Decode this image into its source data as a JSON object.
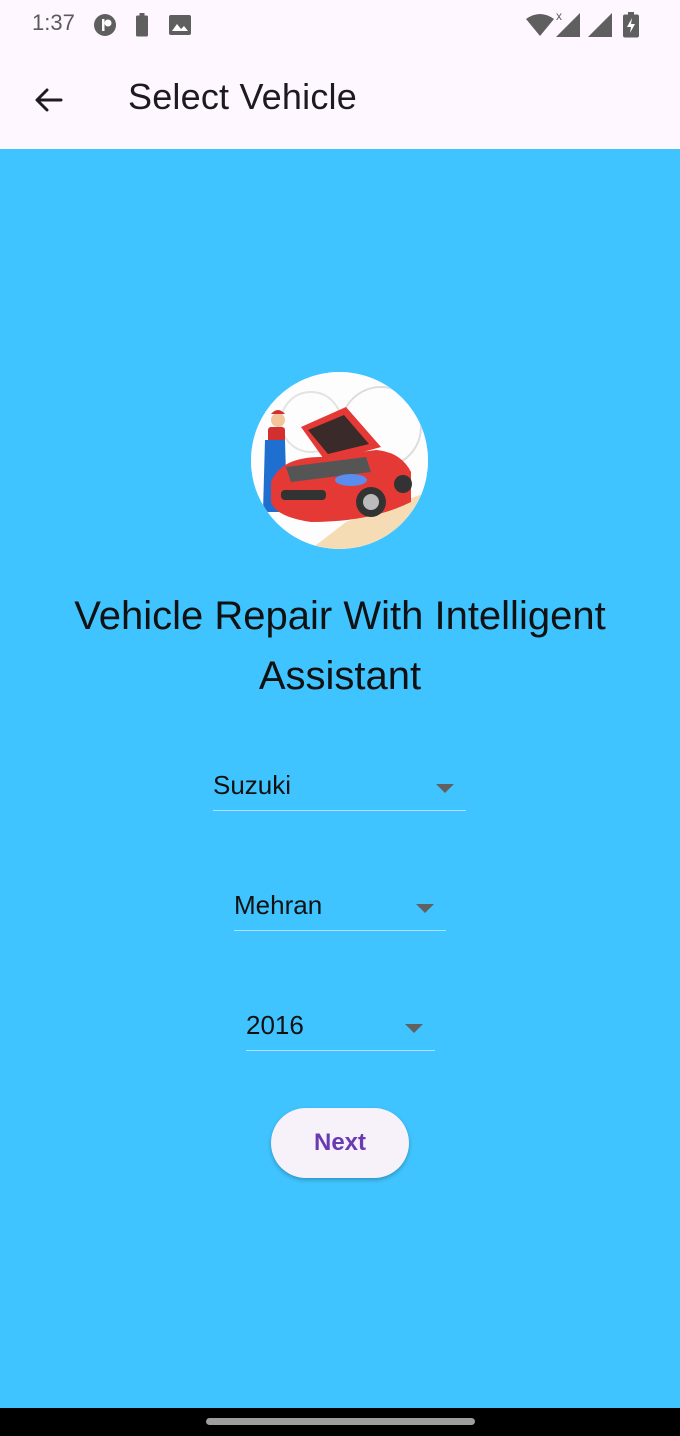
{
  "status_bar": {
    "time": "1:37",
    "left_icons": [
      "app-notification-icon",
      "battery-saver-icon",
      "image-icon"
    ],
    "right_icons": [
      "wifi-icon",
      "cell-signal-no-data-icon",
      "cell-signal-icon",
      "battery-charging-icon"
    ],
    "no_data_mark": "x"
  },
  "app_bar": {
    "title": "Select Vehicle",
    "back_icon": "arrow-back-icon"
  },
  "main": {
    "logo_alt": "Mechanic repairing red car",
    "heading": "Vehicle Repair With Intelligent Assistant",
    "dropdowns": [
      {
        "name": "make",
        "value": "Suzuki"
      },
      {
        "name": "model",
        "value": "Mehran"
      },
      {
        "name": "year",
        "value": "2016"
      }
    ],
    "next_button": "Next"
  },
  "colors": {
    "background": "#40C4FF",
    "app_bar": "#FEF7FF",
    "button_bg": "#F7F2FA",
    "button_text": "#6A3AB2"
  }
}
